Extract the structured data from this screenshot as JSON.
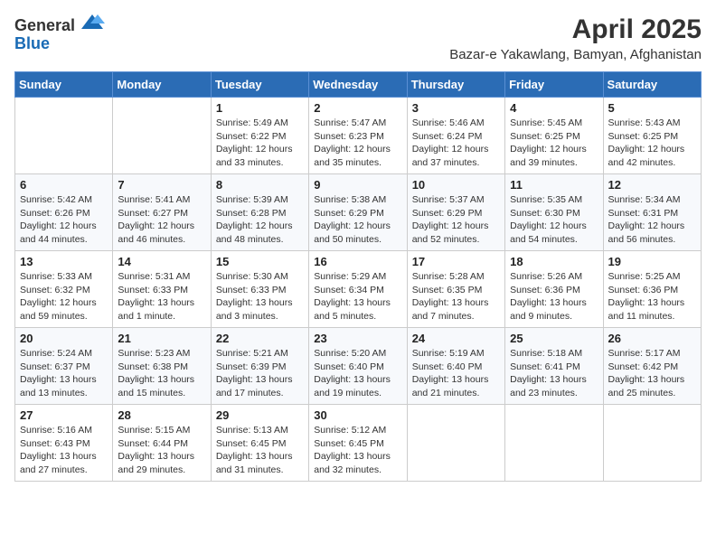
{
  "header": {
    "logo_general": "General",
    "logo_blue": "Blue",
    "month_title": "April 2025",
    "location": "Bazar-e Yakawlang, Bamyan, Afghanistan"
  },
  "days_of_week": [
    "Sunday",
    "Monday",
    "Tuesday",
    "Wednesday",
    "Thursday",
    "Friday",
    "Saturday"
  ],
  "weeks": [
    [
      {
        "day": "",
        "info": ""
      },
      {
        "day": "",
        "info": ""
      },
      {
        "day": "1",
        "info": "Sunrise: 5:49 AM\nSunset: 6:22 PM\nDaylight: 12 hours and 33 minutes."
      },
      {
        "day": "2",
        "info": "Sunrise: 5:47 AM\nSunset: 6:23 PM\nDaylight: 12 hours and 35 minutes."
      },
      {
        "day": "3",
        "info": "Sunrise: 5:46 AM\nSunset: 6:24 PM\nDaylight: 12 hours and 37 minutes."
      },
      {
        "day": "4",
        "info": "Sunrise: 5:45 AM\nSunset: 6:25 PM\nDaylight: 12 hours and 39 minutes."
      },
      {
        "day": "5",
        "info": "Sunrise: 5:43 AM\nSunset: 6:25 PM\nDaylight: 12 hours and 42 minutes."
      }
    ],
    [
      {
        "day": "6",
        "info": "Sunrise: 5:42 AM\nSunset: 6:26 PM\nDaylight: 12 hours and 44 minutes."
      },
      {
        "day": "7",
        "info": "Sunrise: 5:41 AM\nSunset: 6:27 PM\nDaylight: 12 hours and 46 minutes."
      },
      {
        "day": "8",
        "info": "Sunrise: 5:39 AM\nSunset: 6:28 PM\nDaylight: 12 hours and 48 minutes."
      },
      {
        "day": "9",
        "info": "Sunrise: 5:38 AM\nSunset: 6:29 PM\nDaylight: 12 hours and 50 minutes."
      },
      {
        "day": "10",
        "info": "Sunrise: 5:37 AM\nSunset: 6:29 PM\nDaylight: 12 hours and 52 minutes."
      },
      {
        "day": "11",
        "info": "Sunrise: 5:35 AM\nSunset: 6:30 PM\nDaylight: 12 hours and 54 minutes."
      },
      {
        "day": "12",
        "info": "Sunrise: 5:34 AM\nSunset: 6:31 PM\nDaylight: 12 hours and 56 minutes."
      }
    ],
    [
      {
        "day": "13",
        "info": "Sunrise: 5:33 AM\nSunset: 6:32 PM\nDaylight: 12 hours and 59 minutes."
      },
      {
        "day": "14",
        "info": "Sunrise: 5:31 AM\nSunset: 6:33 PM\nDaylight: 13 hours and 1 minute."
      },
      {
        "day": "15",
        "info": "Sunrise: 5:30 AM\nSunset: 6:33 PM\nDaylight: 13 hours and 3 minutes."
      },
      {
        "day": "16",
        "info": "Sunrise: 5:29 AM\nSunset: 6:34 PM\nDaylight: 13 hours and 5 minutes."
      },
      {
        "day": "17",
        "info": "Sunrise: 5:28 AM\nSunset: 6:35 PM\nDaylight: 13 hours and 7 minutes."
      },
      {
        "day": "18",
        "info": "Sunrise: 5:26 AM\nSunset: 6:36 PM\nDaylight: 13 hours and 9 minutes."
      },
      {
        "day": "19",
        "info": "Sunrise: 5:25 AM\nSunset: 6:36 PM\nDaylight: 13 hours and 11 minutes."
      }
    ],
    [
      {
        "day": "20",
        "info": "Sunrise: 5:24 AM\nSunset: 6:37 PM\nDaylight: 13 hours and 13 minutes."
      },
      {
        "day": "21",
        "info": "Sunrise: 5:23 AM\nSunset: 6:38 PM\nDaylight: 13 hours and 15 minutes."
      },
      {
        "day": "22",
        "info": "Sunrise: 5:21 AM\nSunset: 6:39 PM\nDaylight: 13 hours and 17 minutes."
      },
      {
        "day": "23",
        "info": "Sunrise: 5:20 AM\nSunset: 6:40 PM\nDaylight: 13 hours and 19 minutes."
      },
      {
        "day": "24",
        "info": "Sunrise: 5:19 AM\nSunset: 6:40 PM\nDaylight: 13 hours and 21 minutes."
      },
      {
        "day": "25",
        "info": "Sunrise: 5:18 AM\nSunset: 6:41 PM\nDaylight: 13 hours and 23 minutes."
      },
      {
        "day": "26",
        "info": "Sunrise: 5:17 AM\nSunset: 6:42 PM\nDaylight: 13 hours and 25 minutes."
      }
    ],
    [
      {
        "day": "27",
        "info": "Sunrise: 5:16 AM\nSunset: 6:43 PM\nDaylight: 13 hours and 27 minutes."
      },
      {
        "day": "28",
        "info": "Sunrise: 5:15 AM\nSunset: 6:44 PM\nDaylight: 13 hours and 29 minutes."
      },
      {
        "day": "29",
        "info": "Sunrise: 5:13 AM\nSunset: 6:45 PM\nDaylight: 13 hours and 31 minutes."
      },
      {
        "day": "30",
        "info": "Sunrise: 5:12 AM\nSunset: 6:45 PM\nDaylight: 13 hours and 32 minutes."
      },
      {
        "day": "",
        "info": ""
      },
      {
        "day": "",
        "info": ""
      },
      {
        "day": "",
        "info": ""
      }
    ]
  ]
}
